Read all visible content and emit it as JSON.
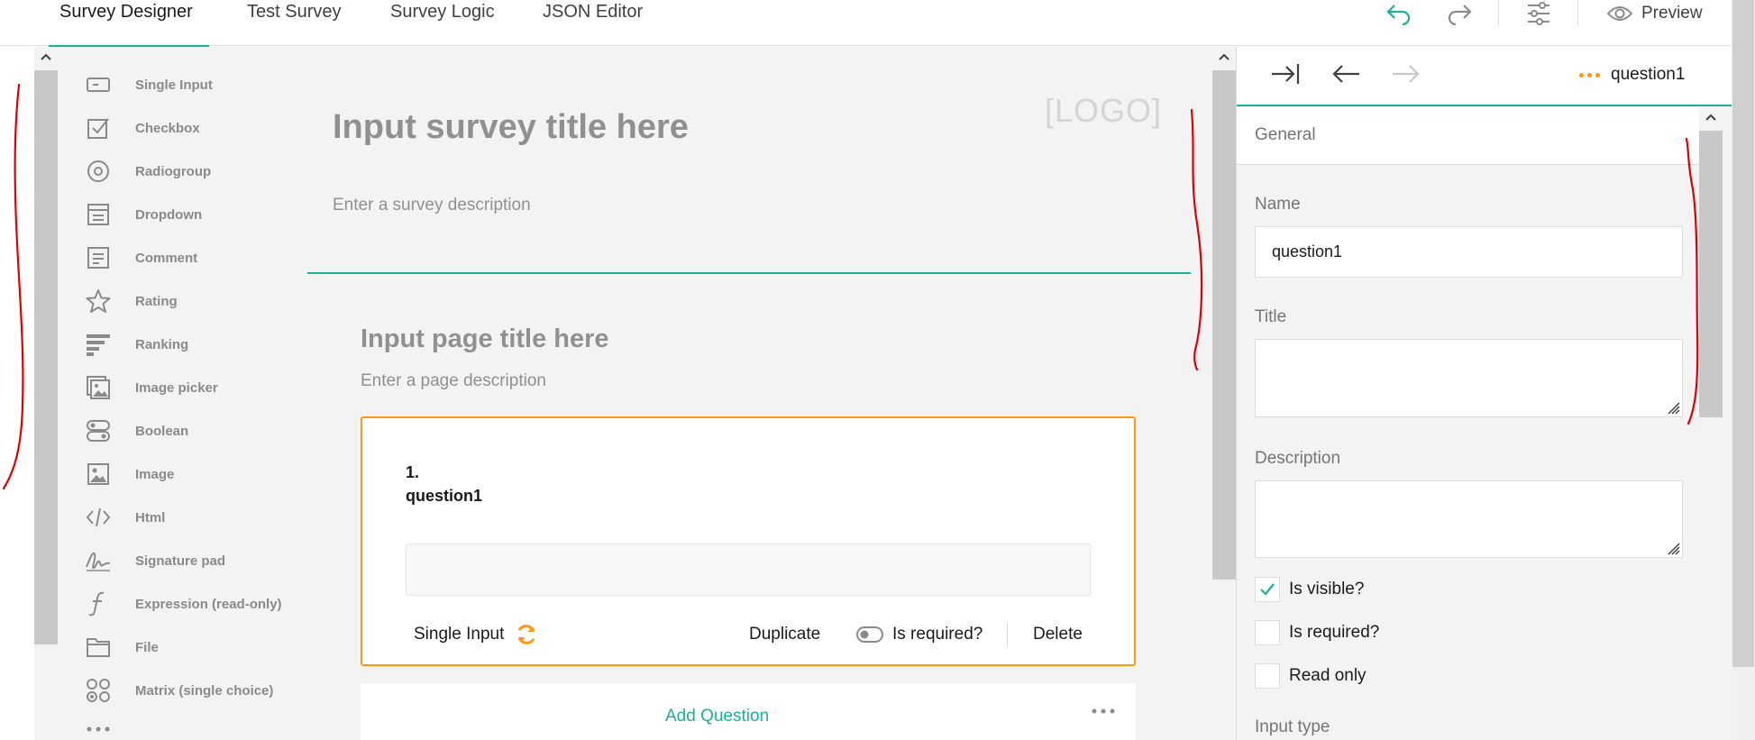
{
  "top_tabs": [
    {
      "label": "Survey Designer",
      "active": true
    },
    {
      "label": "Test Survey",
      "active": false
    },
    {
      "label": "Survey Logic",
      "active": false
    },
    {
      "label": "JSON Editor",
      "active": false
    }
  ],
  "topbar": {
    "icons": [
      "undo-icon",
      "redo-icon",
      "settings-icon"
    ],
    "preview_label": "Preview"
  },
  "toolbox": {
    "items": [
      {
        "label": "Single Input",
        "icon": "single-input-icon"
      },
      {
        "label": "Checkbox",
        "icon": "checkbox-icon"
      },
      {
        "label": "Radiogroup",
        "icon": "radiogroup-icon"
      },
      {
        "label": "Dropdown",
        "icon": "dropdown-icon"
      },
      {
        "label": "Comment",
        "icon": "comment-icon"
      },
      {
        "label": "Rating",
        "icon": "star-icon"
      },
      {
        "label": "Ranking",
        "icon": "ranking-icon"
      },
      {
        "label": "Image picker",
        "icon": "image-picker-icon"
      },
      {
        "label": "Boolean",
        "icon": "boolean-icon"
      },
      {
        "label": "Image",
        "icon": "image-icon"
      },
      {
        "label": "Html",
        "icon": "code-icon"
      },
      {
        "label": "Signature pad",
        "icon": "signature-icon"
      },
      {
        "label": "Expression (read-only)",
        "icon": "function-icon"
      },
      {
        "label": "File",
        "icon": "folder-icon"
      },
      {
        "label": "Matrix (single choice)",
        "icon": "matrix-icon"
      }
    ],
    "more_icon": "more-dots-icon"
  },
  "survey": {
    "title_placeholder": "Input survey title here",
    "logo_placeholder": "[LOGO]",
    "description_placeholder": "Enter a survey description",
    "page_title_placeholder": "Input page title here",
    "page_description_placeholder": "Enter a page description"
  },
  "question": {
    "number": "1.",
    "name": "question1",
    "type_label": "Single Input",
    "duplicate_label": "Duplicate",
    "required_label": "Is required?",
    "delete_label": "Delete"
  },
  "add_question": {
    "label": "Add Question"
  },
  "property_panel": {
    "selected_question": "question1",
    "group_label": "General",
    "fields": {
      "name_label": "Name",
      "name_value": "question1",
      "title_label": "Title",
      "title_value": "",
      "description_label": "Description",
      "description_value": ""
    },
    "checkboxes": [
      {
        "label": "Is visible?",
        "checked": true
      },
      {
        "label": "Is required?",
        "checked": false
      },
      {
        "label": "Read only",
        "checked": false
      }
    ],
    "next_label": "Input type"
  },
  "colors": {
    "accent": "#19b394",
    "selection": "#ff9814",
    "annotation": "#e00000"
  }
}
